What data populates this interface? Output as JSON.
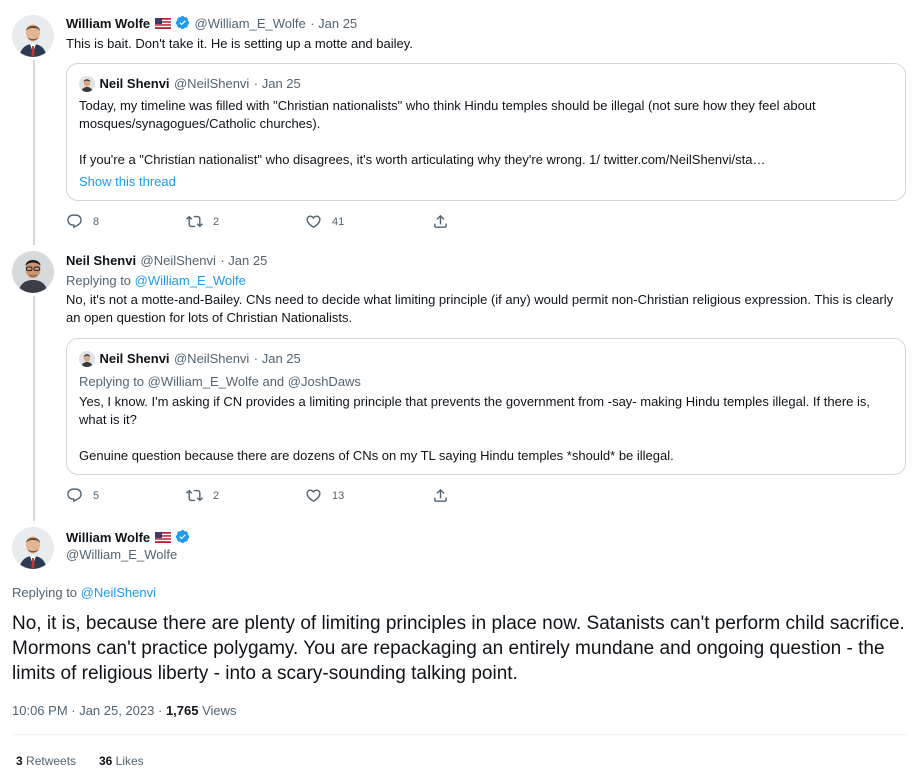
{
  "tweet1": {
    "author_name": "William Wolfe",
    "author_handle": "@William_E_Wolfe",
    "date": "· Jan 25",
    "text": "This is bait. Don't take it. He is setting up a motte and bailey.",
    "quote": {
      "author_name": "Neil Shenvi",
      "author_handle": "@NeilShenvi",
      "date": "· Jan 25",
      "text1": "Today, my timeline was filled with \"Christian nationalists\" who think Hindu temples should be illegal (not sure how they feel about mosques/synagogues/Catholic churches).",
      "text2": "If you're a \"Christian nationalist\" who disagrees, it's worth articulating why they're wrong. 1/ twitter.com/NeilShenvi/sta…",
      "show_thread": "Show this thread"
    },
    "replies": "8",
    "retweets": "2",
    "likes": "41"
  },
  "tweet2": {
    "author_name": "Neil Shenvi",
    "author_handle": "@NeilShenvi",
    "date": "· Jan 25",
    "replying_prefix": "Replying to ",
    "replying_to": "@William_E_Wolfe",
    "text": "No, it's not a motte-and-Bailey. CNs need to decide what limiting principle (if any) would permit non-Christian religious expression. This is clearly an open question for lots of Christian Nationalists.",
    "quote": {
      "author_name": "Neil Shenvi",
      "author_handle": "@NeilShenvi",
      "date": "· Jan 25",
      "replying": "Replying to @William_E_Wolfe and @JoshDaws",
      "text1": "Yes, I know. I'm asking if CN provides a limiting principle that prevents the government from -say- making Hindu temples illegal. If there is, what is it?",
      "text2": "Genuine question because there are dozens of CNs on my TL saying Hindu temples *should* be illegal."
    },
    "replies": "5",
    "retweets": "2",
    "likes": "13"
  },
  "main_tweet": {
    "author_name": "William Wolfe",
    "author_handle": "@William_E_Wolfe",
    "replying_prefix": "Replying to ",
    "replying_to": "@NeilShenvi",
    "text": "No, it is, because there are plenty of limiting principles in place now. Satanists can't perform child sacrifice. Mormons can't practice polygamy. You are repackaging an entirely mundane and ongoing question - the limits of religious liberty - into a scary-sounding talking point.",
    "time": "10:06 PM · Jan 25, 2023 · ",
    "views_count": "1,765",
    "views_label": " Views",
    "retweets_count": "3",
    "retweets_label": " Retweets",
    "likes_count": "36",
    "likes_label": " Likes"
  },
  "colors": {
    "accent": "#1d9bf0",
    "text": "#0f1419",
    "secondary": "#536471",
    "border": "#cfd9de"
  }
}
